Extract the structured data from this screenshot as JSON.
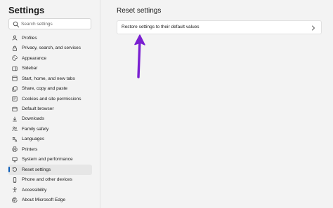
{
  "app": {
    "title": "Settings"
  },
  "search": {
    "placeholder": "Search settings",
    "value": ""
  },
  "sidebar": {
    "items": [
      {
        "label": "Profiles",
        "icon": "profile-icon",
        "active": false
      },
      {
        "label": "Privacy, search, and services",
        "icon": "lock-icon",
        "active": false
      },
      {
        "label": "Appearance",
        "icon": "paint-icon",
        "active": false
      },
      {
        "label": "Sidebar",
        "icon": "sidebar-icon",
        "active": false
      },
      {
        "label": "Start, home, and new tabs",
        "icon": "home-icon",
        "active": false
      },
      {
        "label": "Share, copy and paste",
        "icon": "share-icon",
        "active": false
      },
      {
        "label": "Cookies and site permissions",
        "icon": "cookie-icon",
        "active": false
      },
      {
        "label": "Default browser",
        "icon": "browser-icon",
        "active": false
      },
      {
        "label": "Downloads",
        "icon": "download-icon",
        "active": false
      },
      {
        "label": "Family safety",
        "icon": "family-icon",
        "active": false
      },
      {
        "label": "Languages",
        "icon": "language-icon",
        "active": false
      },
      {
        "label": "Printers",
        "icon": "printer-icon",
        "active": false
      },
      {
        "label": "System and performance",
        "icon": "system-icon",
        "active": false
      },
      {
        "label": "Reset settings",
        "icon": "reset-icon",
        "active": true
      },
      {
        "label": "Phone and other devices",
        "icon": "phone-icon",
        "active": false
      },
      {
        "label": "Accessibility",
        "icon": "accessibility-icon",
        "active": false
      },
      {
        "label": "About Microsoft Edge",
        "icon": "edge-icon",
        "active": false
      }
    ]
  },
  "main": {
    "title": "Reset settings",
    "restore_label": "Restore settings to their default values",
    "chevron_icon": "chevron-right-icon"
  },
  "annotation": {
    "arrow_icon": "arrow-up-annotation",
    "color": "#7a1fd1"
  },
  "colors": {
    "accent": "#0a5cb8",
    "active_bg": "#e6e6e6",
    "background": "#f3f3f3",
    "card_bg": "#ffffff"
  }
}
